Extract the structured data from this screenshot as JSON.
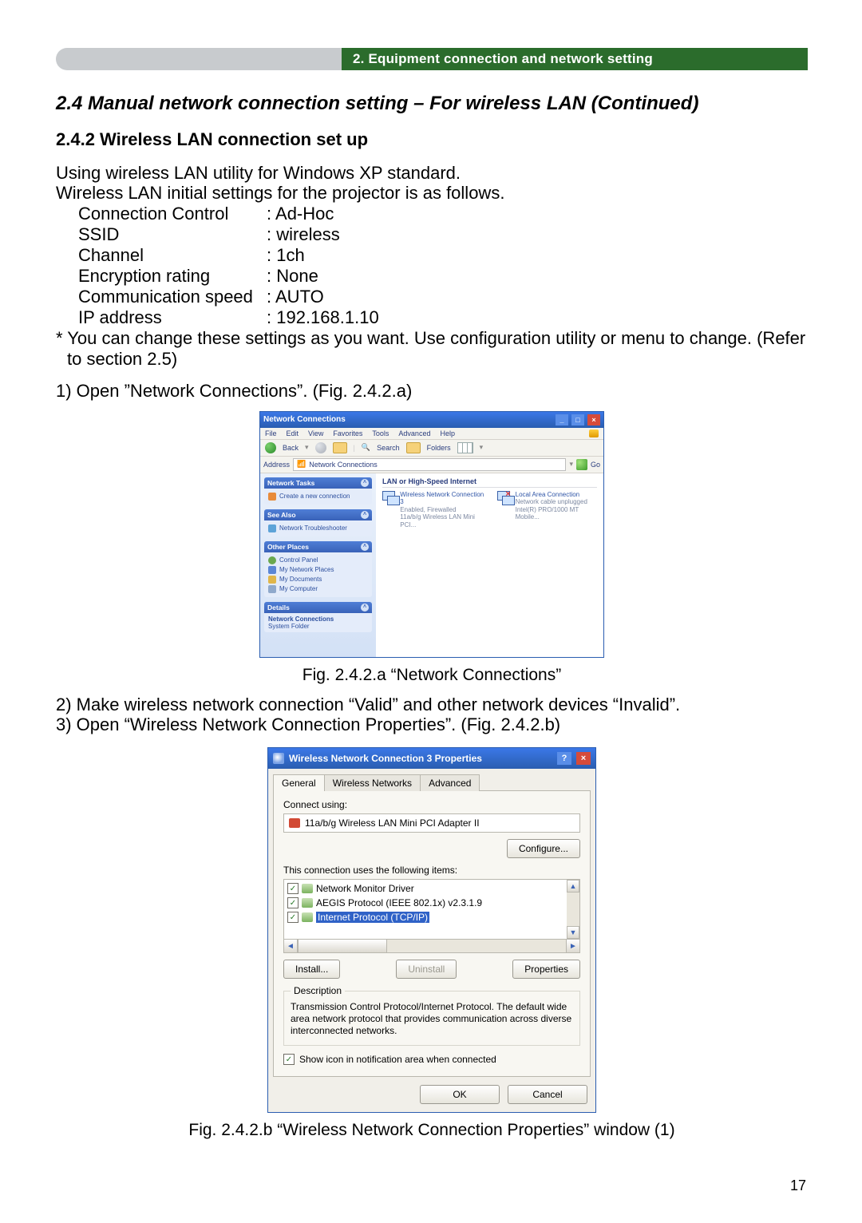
{
  "header": {
    "section_label": "2. Equipment connection and network setting"
  },
  "section_title": "2.4 Manual network connection setting – For wireless LAN (Continued)",
  "subsection_title": "2.4.2 Wireless LAN connection set up",
  "intro1": "Using wireless LAN utility for Windows XP standard.",
  "intro2": "Wireless LAN initial settings for the projector is as follows.",
  "settings": {
    "rows": [
      {
        "k": "Connection Control",
        "v": "Ad-Hoc"
      },
      {
        "k": "SSID",
        "v": "wireless"
      },
      {
        "k": "Channel",
        "v": "1ch"
      },
      {
        "k": "Encryption rating",
        "v": "None"
      },
      {
        "k": "Communication speed",
        "v": ": AUTO",
        "nosep": true
      },
      {
        "k": "IP address",
        "v": "192.168.1.10"
      }
    ]
  },
  "note": "* You can change these settings as you want. Use configuration utility or menu to change. (Refer to section 2.5)",
  "step1": "1) Open ”Network Connections”. (Fig. 2.4.2.a)",
  "nc": {
    "title": "Network Connections",
    "menu": [
      "File",
      "Edit",
      "View",
      "Favorites",
      "Tools",
      "Advanced",
      "Help"
    ],
    "back": "Back",
    "search": "Search",
    "folders": "Folders",
    "addr_label": "Address",
    "addr_value": "Network Connections",
    "go": "Go",
    "panel_tasks_title": "Network Tasks",
    "task_new": "Create a new connection",
    "panel_seealso_title": "See Also",
    "seealso_item": "Network Troubleshooter",
    "panel_other_title": "Other Places",
    "other_items": [
      "Control Panel",
      "My Network Places",
      "My Documents",
      "My Computer"
    ],
    "panel_details_title": "Details",
    "details_line1": "Network Connections",
    "details_line2": "System Folder",
    "group_label": "LAN or High-Speed Internet",
    "conn1_line1": "Wireless Network Connection 3",
    "conn1_line2": "Enabled, Firewalled",
    "conn1_line3": "11a/b/g Wireless LAN Mini PCI...",
    "conn2_line1": "Local Area Connection",
    "conn2_line2": "Network cable unplugged",
    "conn2_line3": "Intel(R) PRO/1000 MT Mobile..."
  },
  "fig_a_caption": "Fig. 2.4.2.a “Network Connections”",
  "step2": "2) Make wireless network connection “Valid” and other network devices “Invalid”.",
  "step3": "3) Open “Wireless Network Connection Properties”. (Fig. 2.4.2.b)",
  "prop": {
    "title": "Wireless Network Connection 3 Properties",
    "tabs": {
      "general": "General",
      "wireless": "Wireless Networks",
      "advanced": "Advanced"
    },
    "connect_using": "Connect using:",
    "adapter": "11a/b/g Wireless LAN Mini PCI Adapter II",
    "configure": "Configure...",
    "uses_items": "This connection uses the following items:",
    "items": [
      "Network Monitor Driver",
      "AEGIS Protocol (IEEE 802.1x) v2.3.1.9",
      "Internet Protocol (TCP/IP)"
    ],
    "install": "Install...",
    "uninstall": "Uninstall",
    "properties": "Properties",
    "desc_legend": "Description",
    "desc_text": "Transmission Control Protocol/Internet Protocol. The default wide area network protocol that provides communication across diverse interconnected networks.",
    "show_icon": "Show icon in notification area when connected",
    "ok": "OK",
    "cancel": "Cancel"
  },
  "fig_b_caption": "Fig. 2.4.2.b “Wireless Network Connection Properties” window (1)",
  "page_number": "17"
}
